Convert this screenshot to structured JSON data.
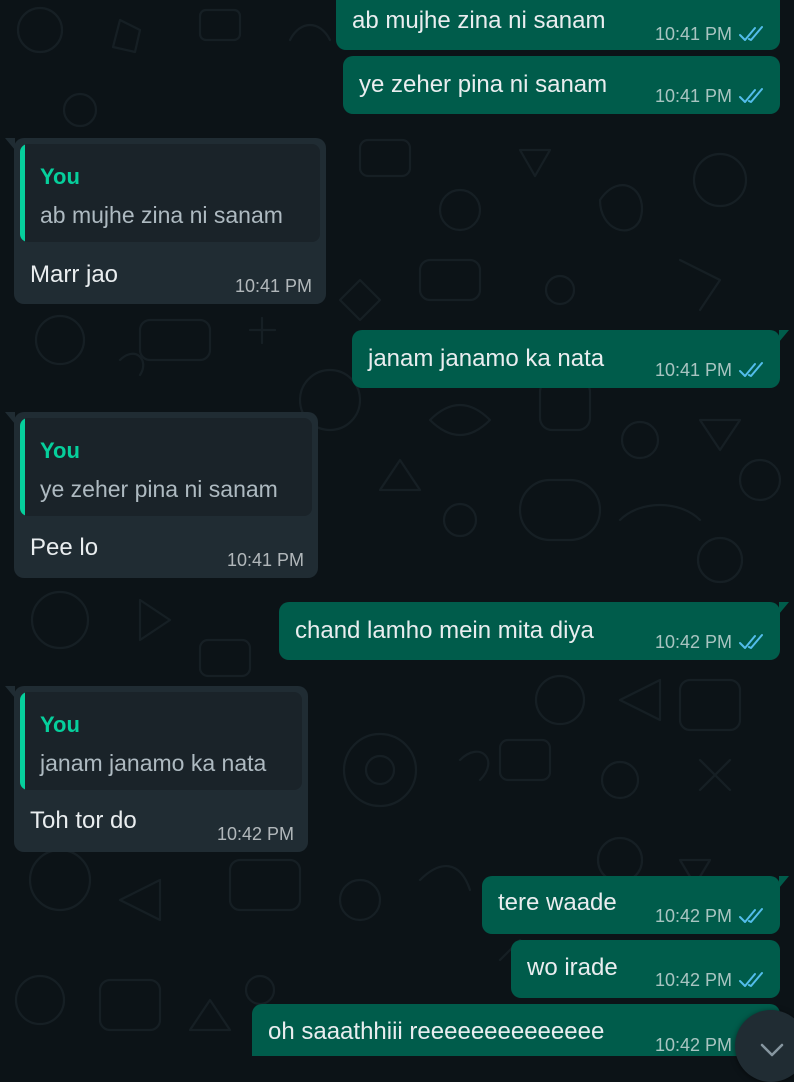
{
  "chat": {
    "messages": [
      {
        "type": "outgoing",
        "text": "ab mujhe zina ni sanam",
        "time": "10:41 PM",
        "status": "read"
      },
      {
        "type": "outgoing",
        "text": "ye zeher pina ni sanam",
        "time": "10:41 PM",
        "status": "read"
      },
      {
        "type": "incoming",
        "quoted_author": "You",
        "quoted_text": "ab mujhe zina ni sanam",
        "text": "Marr jao",
        "time": "10:41 PM"
      },
      {
        "type": "outgoing",
        "text": "janam janamo ka nata",
        "time": "10:41 PM",
        "status": "read"
      },
      {
        "type": "incoming",
        "quoted_author": "You",
        "quoted_text": "ye zeher pina ni sanam",
        "text": "Pee lo",
        "time": "10:41 PM"
      },
      {
        "type": "outgoing",
        "text": "chand lamho mein mita diya",
        "time": "10:42 PM",
        "status": "read"
      },
      {
        "type": "incoming",
        "quoted_author": "You",
        "quoted_text": "janam janamo ka nata",
        "text": "Toh tor do",
        "time": "10:42 PM"
      },
      {
        "type": "outgoing",
        "text": "tere waade",
        "time": "10:42 PM",
        "status": "read"
      },
      {
        "type": "outgoing",
        "text": "wo irade",
        "time": "10:42 PM",
        "status": "read"
      },
      {
        "type": "outgoing",
        "text": "oh saaathhiii reeeeeeeeeeeeee",
        "time": "10:42 PM",
        "status": "read"
      }
    ]
  },
  "icons": {
    "read_receipt": "double-check-icon",
    "scroll_down": "chevron-down-icon"
  },
  "colors": {
    "background": "#0c1317",
    "outgoing_bubble": "#005c4b",
    "incoming_bubble": "#202c33",
    "quote_accent": "#06cf9c",
    "read_tick": "#53bdeb"
  }
}
